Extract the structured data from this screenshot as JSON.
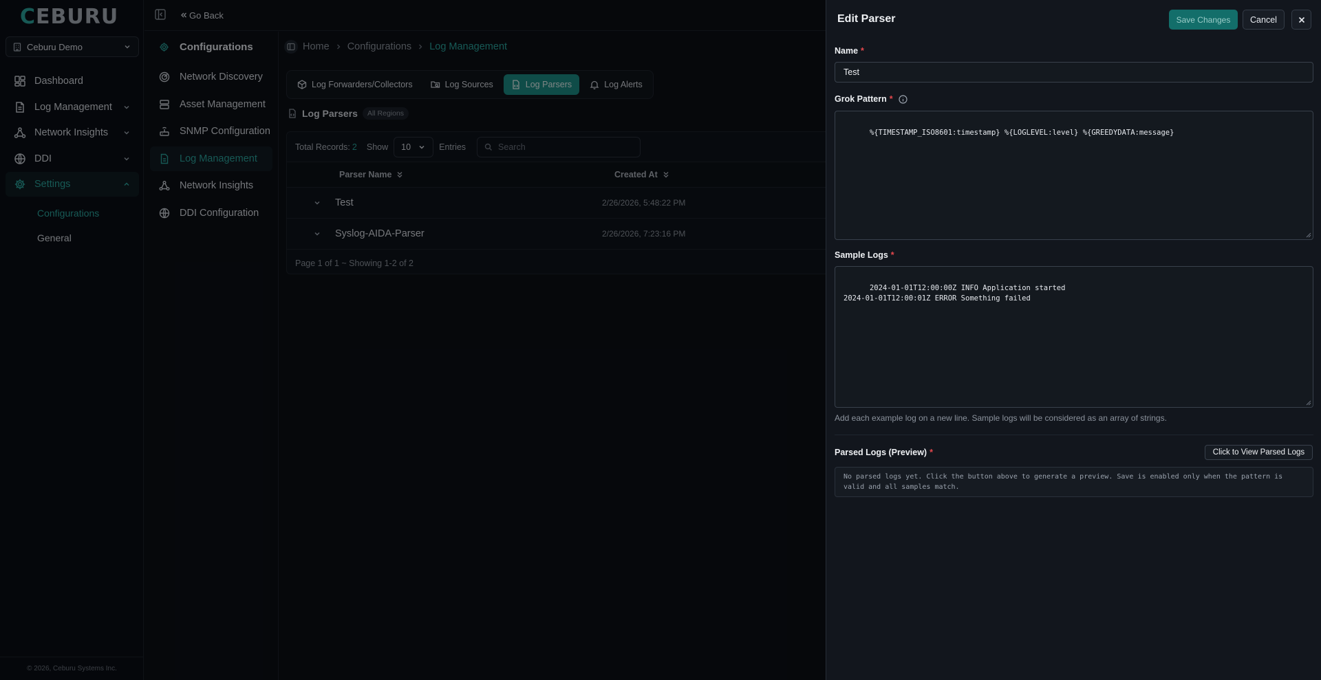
{
  "brand": {
    "logo_first": "C",
    "logo_rest": "EBURU"
  },
  "org": {
    "name": "Ceburu Demo"
  },
  "nav": {
    "items": [
      {
        "label": "Dashboard"
      },
      {
        "label": "Log Management"
      },
      {
        "label": "Network Insights"
      },
      {
        "label": "DDI"
      },
      {
        "label": "Settings"
      }
    ],
    "settings_sub": [
      {
        "label": "Configurations"
      },
      {
        "label": "General"
      }
    ]
  },
  "footer": {
    "text": "© 2026, Ceburu Systems Inc."
  },
  "topbar": {
    "go_back": "Go Back"
  },
  "config_sidebar": {
    "title": "Configurations",
    "items": [
      {
        "label": "Network Discovery"
      },
      {
        "label": "Asset Management"
      },
      {
        "label": "SNMP Configuration"
      },
      {
        "label": "Log Management"
      },
      {
        "label": "Network Insights"
      },
      {
        "label": "DDI Configuration"
      }
    ]
  },
  "breadcrumb": {
    "home": "Home",
    "section": "Configurations",
    "current": "Log Management"
  },
  "tabs": [
    {
      "label": "Log Forwarders/Collectors"
    },
    {
      "label": "Log Sources"
    },
    {
      "label": "Log Parsers"
    },
    {
      "label": "Log Alerts"
    }
  ],
  "log_parsers": {
    "title": "Log Parsers",
    "region_badge": "All Regions",
    "total_label": "Total Records:",
    "total_count": "2",
    "show_label": "Show",
    "page_size": "10",
    "entries_label": "Entries",
    "search_placeholder": "Search",
    "columns": {
      "name": "Parser Name",
      "created": "Created At"
    },
    "rows": [
      {
        "name": "Test",
        "created": "2/26/2026, 5:48:22 PM"
      },
      {
        "name": "Syslog-AIDA-Parser",
        "created": "2/26/2026, 7:23:16 PM"
      }
    ],
    "pager": "Page 1 of 1 ~ Showing 1-2 of 2"
  },
  "drawer": {
    "title": "Edit Parser",
    "save_label": "Save Changes",
    "cancel_label": "Cancel",
    "name_label": "Name",
    "name_value": "Test",
    "grok_label": "Grok Pattern",
    "grok_value": "%{TIMESTAMP_ISO8601:timestamp} %{LOGLEVEL:level} %{GREEDYDATA:message}",
    "samples_label": "Sample Logs",
    "samples_value": "2024-01-01T12:00:00Z INFO Application started\n2024-01-01T12:00:01Z ERROR Something failed",
    "samples_hint": "Add each example log on a new line. Sample logs will be considered as an array of strings.",
    "parsed_label": "Parsed Logs (Preview)",
    "view_button": "Click to View Parsed Logs",
    "parsed_placeholder": "No parsed logs yet. Click the button above to generate a preview. Save is enabled only when the pattern is\nvalid and all samples match.",
    "required_mark": "*"
  },
  "colors": {
    "accent": "#2aa39c",
    "required": "#e5484d",
    "save_button": "#136e6a"
  }
}
